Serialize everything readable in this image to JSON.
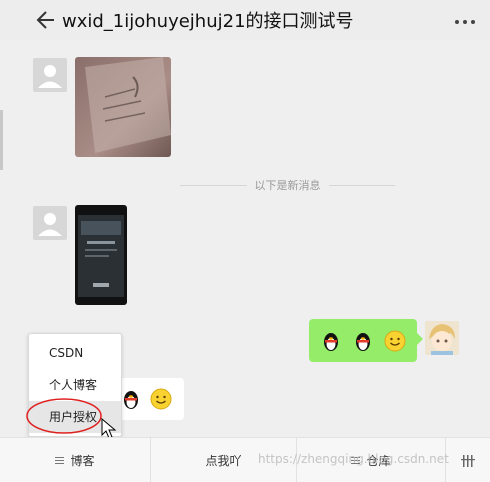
{
  "header": {
    "title": "wxid_1ijohuyejhuj21的接口测试号",
    "back_icon": "arrow-left-icon",
    "more_icon": "more-dots-icon"
  },
  "chat": {
    "divider_text": "以下是新消息"
  },
  "popup_menu": {
    "items": [
      {
        "label": "CSDN"
      },
      {
        "label": "个人博客"
      },
      {
        "label": "用户授权"
      }
    ]
  },
  "bottom_menu": {
    "items": [
      {
        "label": "博客"
      },
      {
        "label": "点我吖"
      },
      {
        "label": "仓库"
      }
    ]
  },
  "watermark": "https://zhengqing.blog.csdn.net",
  "colors": {
    "bubble_green": "#95ec69",
    "annotation_red": "#e02020",
    "background": "#efefef"
  }
}
